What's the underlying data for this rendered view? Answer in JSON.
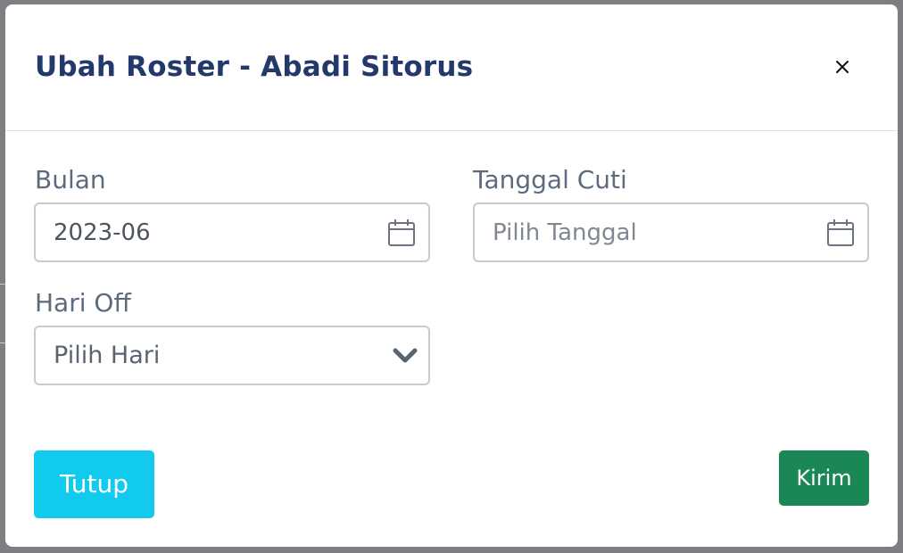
{
  "modal": {
    "title": "Ubah Roster - Abadi Sitorus",
    "close_symbol": "×"
  },
  "form": {
    "bulan": {
      "label": "Bulan",
      "value": "2023-06",
      "icon": "calendar-icon"
    },
    "tanggal_cuti": {
      "label": "Tanggal Cuti",
      "value": "",
      "placeholder": "Pilih Tanggal",
      "icon": "calendar-icon"
    },
    "hari_off": {
      "label": "Hari Off",
      "selected": "Pilih Hari",
      "icon": "chevron-down-icon"
    }
  },
  "footer": {
    "tutup_label": "Tutup",
    "kirim_label": "Kirim"
  },
  "colors": {
    "title": "#23386b",
    "label": "#5d6b7e",
    "tutup_bg": "#12c9ee",
    "kirim_bg": "#1a8754",
    "backdrop": "#7d7f82"
  }
}
